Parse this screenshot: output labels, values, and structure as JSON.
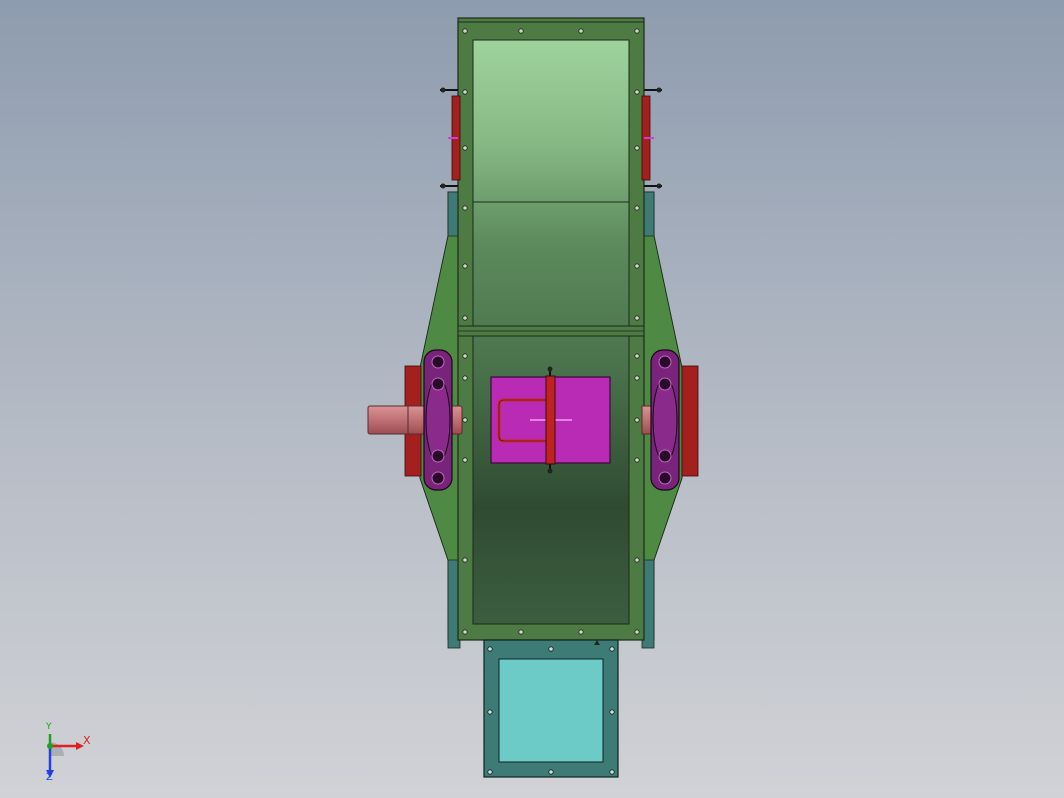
{
  "view": {
    "background_top": "#8e9caf",
    "background_bottom": "#d1d2d6"
  },
  "model": {
    "parts": [
      {
        "name": "housing-frame",
        "color": "#4e7a44"
      },
      {
        "name": "inlet-chute",
        "color": "#9ccf9a"
      },
      {
        "name": "outlet-flange",
        "color": "#3e7a76"
      },
      {
        "name": "outlet-opening",
        "color": "#6ccbc6"
      },
      {
        "name": "inspection-door",
        "color": "#b92ab5"
      },
      {
        "name": "bearing-housing",
        "color": "#8a2a8a"
      },
      {
        "name": "drive-shaft",
        "color": "#c8797c"
      },
      {
        "name": "bracket",
        "color": "#a4201f"
      }
    ]
  },
  "triad": {
    "x_label": "X",
    "y_label": "Y",
    "z_label": "Z",
    "x_color": "#e02020",
    "y_color": "#20a020",
    "z_color": "#2040e0"
  }
}
